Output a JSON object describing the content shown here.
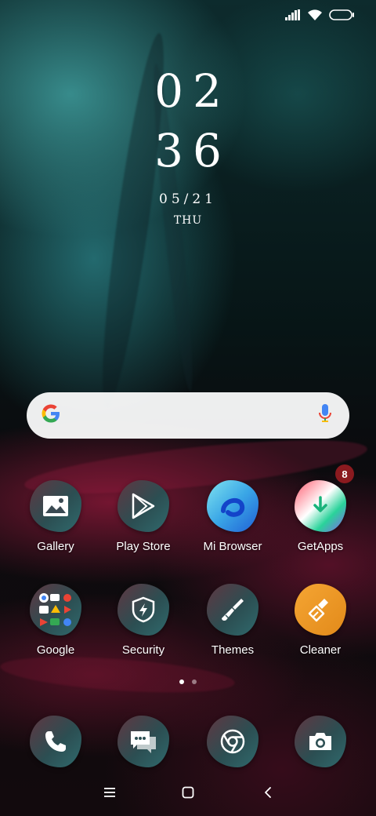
{
  "status_bar": {
    "icons": [
      "signal-icon",
      "wifi-icon",
      "battery-icon"
    ]
  },
  "clock": {
    "hour": "02",
    "minute": "36",
    "date": "05/21",
    "day": "THU"
  },
  "search": {
    "provider_icon": "google-g-icon",
    "voice_icon": "microphone-icon"
  },
  "apps_row1": [
    {
      "label": "Gallery",
      "icon": "gallery-icon"
    },
    {
      "label": "Play Store",
      "icon": "play-store-icon"
    },
    {
      "label": "Mi Browser",
      "icon": "mi-browser-icon"
    },
    {
      "label": "GetApps",
      "icon": "getapps-icon",
      "badge": "8"
    }
  ],
  "apps_row2": [
    {
      "label": "Google",
      "icon": "google-folder-icon"
    },
    {
      "label": "Security",
      "icon": "security-icon"
    },
    {
      "label": "Themes",
      "icon": "themes-icon"
    },
    {
      "label": "Cleaner",
      "icon": "cleaner-icon"
    }
  ],
  "page_indicator": {
    "pages": 2,
    "current": 1
  },
  "dock": [
    {
      "icon": "phone-icon"
    },
    {
      "icon": "messages-icon"
    },
    {
      "icon": "chrome-icon"
    },
    {
      "icon": "camera-icon"
    }
  ],
  "nav_bar": {
    "buttons": [
      "menu-icon",
      "home-icon",
      "back-icon"
    ]
  },
  "colors": {
    "badge": "#8b1a1f",
    "wallpaper_teal": "#2f7d7f",
    "wallpaper_crimson": "#9a1a3a"
  }
}
